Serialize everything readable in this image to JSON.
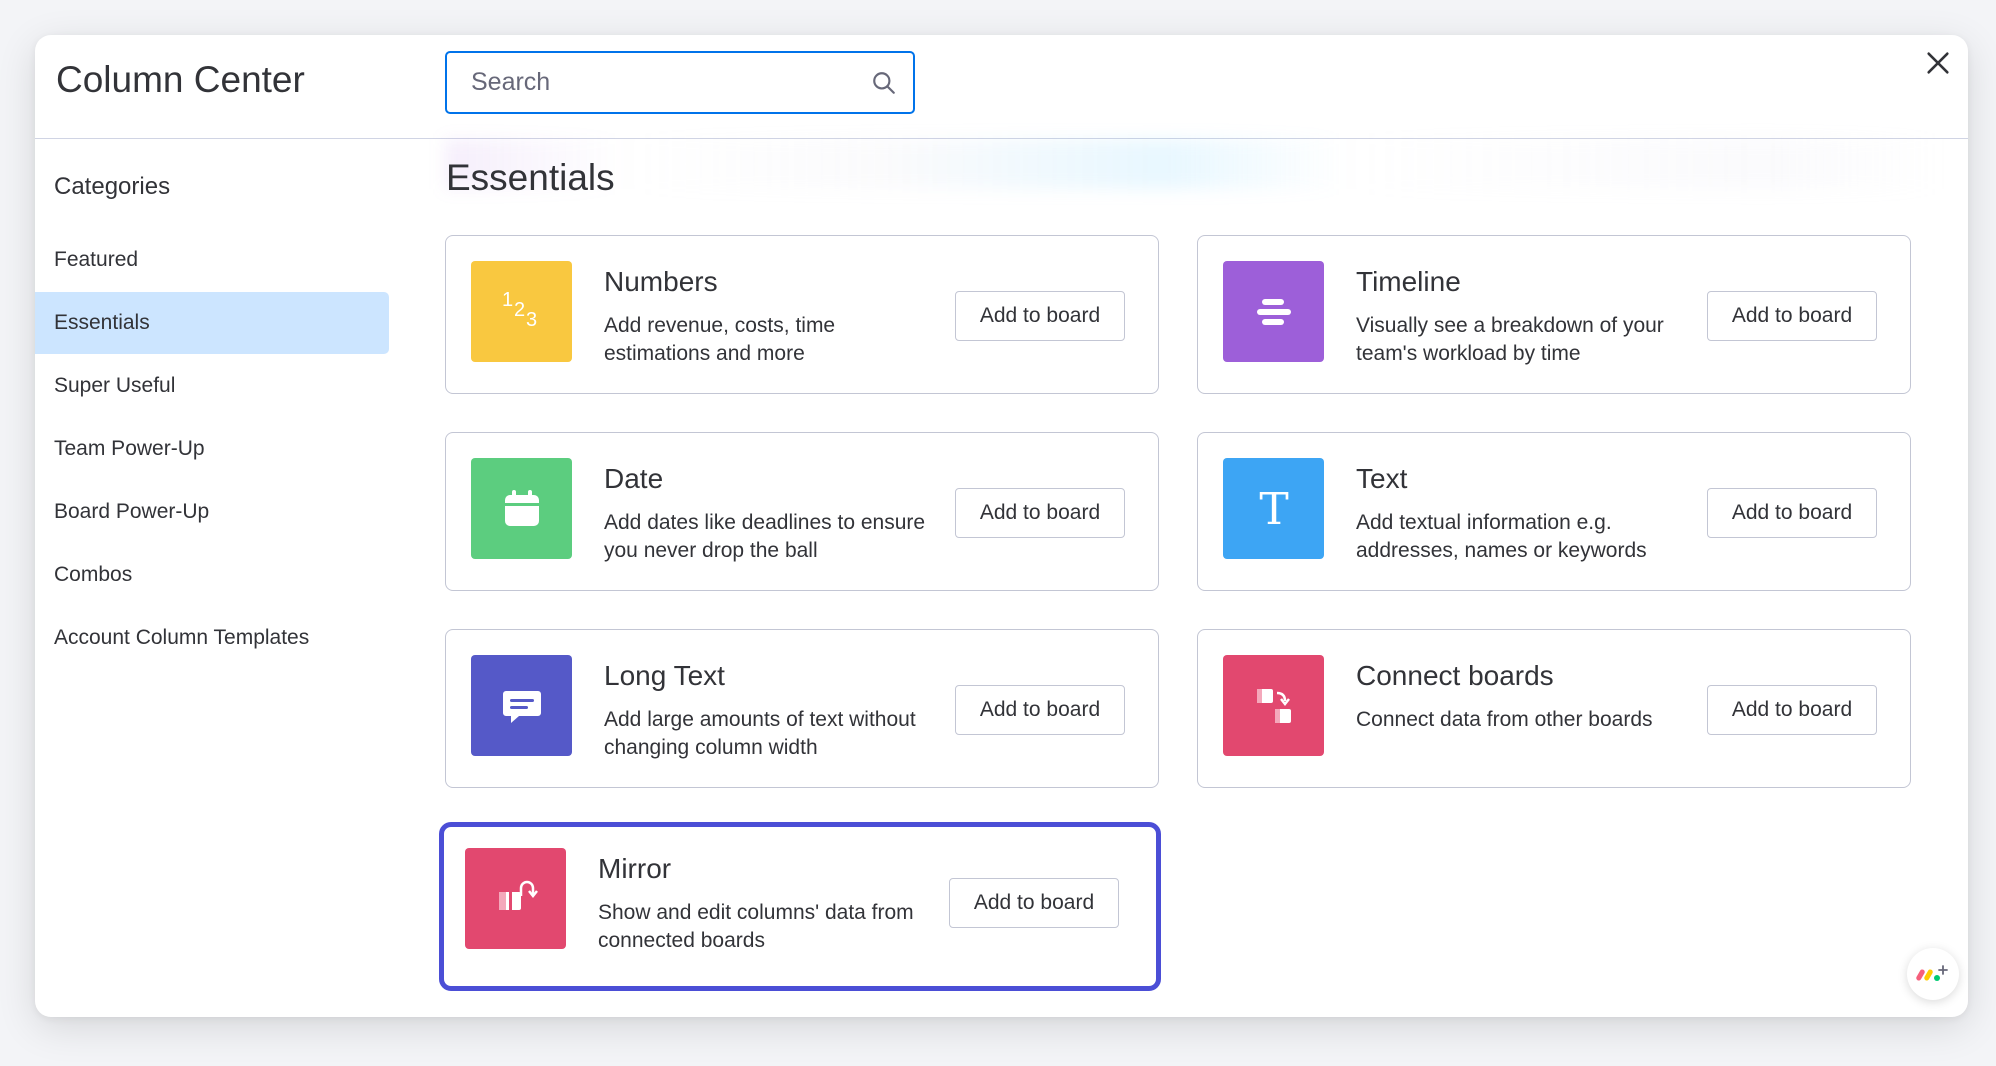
{
  "header": {
    "title": "Column Center",
    "search_placeholder": "Search"
  },
  "sidebar": {
    "heading": "Categories",
    "items": [
      {
        "label": "Featured",
        "active": false
      },
      {
        "label": "Essentials",
        "active": true
      },
      {
        "label": "Super Useful",
        "active": false
      },
      {
        "label": "Team Power-Up",
        "active": false
      },
      {
        "label": "Board Power-Up",
        "active": false
      },
      {
        "label": "Combos",
        "active": false
      },
      {
        "label": "Account Column Templates",
        "active": false
      }
    ]
  },
  "main": {
    "section_title": "Essentials",
    "cards": [
      {
        "name": "Numbers",
        "description": "Add revenue, costs, time estimations and more",
        "button_label": "Add to board",
        "icon": "numbers-icon",
        "color": "#f9c840",
        "selected": false
      },
      {
        "name": "Timeline",
        "description": "Visually see a breakdown of your team's workload by time",
        "button_label": "Add to board",
        "icon": "timeline-icon",
        "color": "#9d5fd9",
        "selected": false
      },
      {
        "name": "Date",
        "description": "Add dates like deadlines to ensure you never drop the ball",
        "button_label": "Add to board",
        "icon": "calendar-icon",
        "color": "#5ccd7f",
        "selected": false
      },
      {
        "name": "Text",
        "description": "Add textual information e.g. addresses, names or keywords",
        "button_label": "Add to board",
        "icon": "text-icon",
        "color": "#3da5f4",
        "selected": false
      },
      {
        "name": "Long Text",
        "description": "Add large amounts of text without changing column width",
        "button_label": "Add to board",
        "icon": "speech-bubble-icon",
        "color": "#5559c8",
        "selected": false
      },
      {
        "name": "Connect boards",
        "description": "Connect data from other boards",
        "button_label": "Add to board",
        "icon": "connect-boards-icon",
        "color": "#e2486f",
        "selected": false
      },
      {
        "name": "Mirror",
        "description": "Show and edit columns' data from connected boards",
        "button_label": "Add to board",
        "icon": "mirror-icon",
        "color": "#e2486f",
        "selected": true
      }
    ]
  },
  "colors": {
    "accent": "#0073ea",
    "selected_border": "#4b4ed6",
    "active_category_bg": "#cce5ff"
  }
}
